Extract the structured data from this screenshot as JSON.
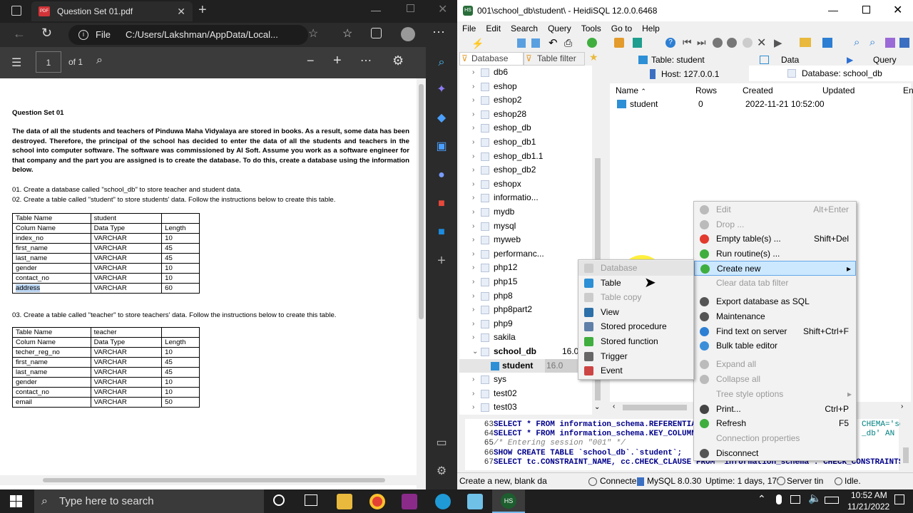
{
  "edge": {
    "tab_title": "Question Set 01.pdf",
    "file_label": "File",
    "url": "C:/Users/Lakshman/AppData/Local...",
    "page_num": "1",
    "page_total": "of 1"
  },
  "pdf": {
    "heading": "Question Set 01",
    "intro": "The data of all the students and teachers of Pinduwa Maha Vidyalaya are stored in books. As a result, some data has been destroyed. Therefore, the principal of the school has decided to enter the data of all the students and teachers in the school into computer software. The software was commissioned by AI Soft. Assume you work as a software engineer for that company and the part you are assigned is to create the database. To do this, create a database using the information below.",
    "q1": "01. Create a database called \"school_db\" to store teacher and student data.",
    "q2": "02. Create a table called \"student\" to store students' data. Follow the instructions below to create this table.",
    "q3": "03. Create a table called \"teacher\" to store teachers' data. Follow the instructions below to create this table.",
    "student_table": [
      [
        "Table Name",
        "student",
        ""
      ],
      [
        "Colum Name",
        "Data Type",
        "Length"
      ],
      [
        "index_no",
        "VARCHAR",
        "10"
      ],
      [
        "first_name",
        "VARCHAR",
        "45"
      ],
      [
        "last_name",
        "VARCHAR",
        "45"
      ],
      [
        "gender",
        "VARCHAR",
        "10"
      ],
      [
        "contact_no",
        "VARCHAR",
        "10"
      ],
      [
        "address",
        "VARCHAR",
        "60"
      ]
    ],
    "teacher_table": [
      [
        "Table Name",
        "teacher",
        ""
      ],
      [
        "Colum Name",
        "Data Type",
        "Length"
      ],
      [
        "techer_reg_no",
        "VARCHAR",
        "10"
      ],
      [
        "first_name",
        "VARCHAR",
        "45"
      ],
      [
        "last_name",
        "VARCHAR",
        "45"
      ],
      [
        "gender",
        "VARCHAR",
        "10"
      ],
      [
        "contact_no",
        "VARCHAR",
        "10"
      ],
      [
        "email",
        "VARCHAR",
        "50"
      ]
    ]
  },
  "heidi": {
    "title": "001\\school_db\\student\\ - HeidiSQL 12.0.0.6468",
    "menu": [
      "File",
      "Edit",
      "Search",
      "Query",
      "Tools",
      "Go to",
      "Help"
    ],
    "filter_db": "Database filter",
    "filter_table": "Table filter",
    "tabs": [
      "Table: student",
      "Data",
      "Query"
    ],
    "subtabs": [
      "Host: 127.0.0.1",
      "Database: school_db"
    ],
    "tree": [
      "db6",
      "eshop",
      "eshop2",
      "eshop28",
      "eshop_db",
      "eshop_db1",
      "eshop_db1.1",
      "eshop_db2",
      "eshopx",
      "informatio...",
      "mydb",
      "mysql",
      "myweb",
      "performanc...",
      "php12",
      "php15",
      "php8",
      "php8part2",
      "php9",
      "sakila",
      "school_db",
      "student",
      "sys",
      "test02",
      "test03"
    ],
    "school_size": "16.0",
    "student_size": "16.0",
    "columns": [
      "Name",
      "Rows",
      "Created",
      "Updated",
      "En"
    ],
    "row": {
      "name": "student",
      "rows": "0",
      "created": "2022-11-21 10:52:00"
    },
    "sql": [
      {
        "n": "63",
        "code": "SELECT * FROM information_schema.REFERENTIA",
        "tail": "CHEMA='sch"
      },
      {
        "n": "64",
        "code": "SELECT * FROM information_schema.KEY_COLUMN",
        "tail": "_db'   AN"
      },
      {
        "n": "65",
        "code": "/* Entering session \"001\" */",
        "tail": ""
      },
      {
        "n": "66",
        "code": "SHOW CREATE TABLE `school_db`.`student`;",
        "tail": ""
      },
      {
        "n": "67",
        "code": "SELECT tc.CONSTRAINT_NAME, cc.CHECK_CLAUSE FROM `information_schema`.`CHECK_CONSTRAINTS`",
        "tail": ""
      }
    ],
    "status": [
      "Create a new, blank da",
      "Connecte",
      "MySQL 8.0.30",
      "Uptime: 1 days, 17:",
      "Server tin",
      "Idle."
    ]
  },
  "context_main": [
    {
      "label": "Edit",
      "shortcut": "Alt+Enter",
      "disabled": true,
      "icon": "edit-icon"
    },
    {
      "label": "Drop ...",
      "shortcut": "",
      "disabled": true,
      "icon": "drop-icon"
    },
    {
      "label": "Empty table(s) ...",
      "shortcut": "Shift+Del",
      "disabled": false,
      "icon": "empty-table-icon"
    },
    {
      "label": "Run routine(s) ...",
      "shortcut": "",
      "disabled": false,
      "icon": "run-routine-icon"
    },
    {
      "label": "Create new",
      "shortcut": "",
      "disabled": false,
      "icon": "create-new-icon",
      "highlight": true
    },
    {
      "label": "Clear data tab filter",
      "shortcut": "",
      "disabled": true,
      "icon": ""
    },
    {
      "label": "Export database as SQL",
      "shortcut": "",
      "disabled": false,
      "icon": "export-icon"
    },
    {
      "label": "Maintenance",
      "shortcut": "",
      "disabled": false,
      "icon": "maintenance-icon"
    },
    {
      "label": "Find text on server",
      "shortcut": "Shift+Ctrl+F",
      "disabled": false,
      "icon": "find-icon"
    },
    {
      "label": "Bulk table editor",
      "shortcut": "",
      "disabled": false,
      "icon": "bulk-editor-icon"
    },
    {
      "label": "Expand all",
      "shortcut": "",
      "disabled": true,
      "icon": "expand-icon"
    },
    {
      "label": "Collapse all",
      "shortcut": "",
      "disabled": true,
      "icon": "collapse-icon"
    },
    {
      "label": "Tree style options",
      "shortcut": "",
      "disabled": true,
      "icon": ""
    },
    {
      "label": "Print...",
      "shortcut": "Ctrl+P",
      "disabled": false,
      "icon": "print-icon"
    },
    {
      "label": "Refresh",
      "shortcut": "F5",
      "disabled": false,
      "icon": "refresh-icon"
    },
    {
      "label": "Connection properties",
      "shortcut": "",
      "disabled": true,
      "icon": ""
    },
    {
      "label": "Disconnect",
      "shortcut": "",
      "disabled": false,
      "icon": "disconnect-icon"
    }
  ],
  "context_sub": [
    {
      "label": "Database",
      "disabled": true,
      "icon": "database-icon"
    },
    {
      "label": "Table",
      "disabled": false,
      "icon": "table-icon"
    },
    {
      "label": "Table copy",
      "disabled": true,
      "icon": "table-copy-icon"
    },
    {
      "label": "View",
      "disabled": false,
      "icon": "view-icon"
    },
    {
      "label": "Stored procedure",
      "disabled": false,
      "icon": "procedure-icon"
    },
    {
      "label": "Stored function",
      "disabled": false,
      "icon": "function-icon"
    },
    {
      "label": "Trigger",
      "disabled": false,
      "icon": "trigger-icon"
    },
    {
      "label": "Event",
      "disabled": false,
      "icon": "event-icon"
    }
  ],
  "taskbar": {
    "search_placeholder": "Type here to search",
    "time": "10:52 AM",
    "date": "11/21/2022"
  },
  "colors": {
    "highlight": "#cce8ff",
    "menu_hover": "#3399ff",
    "accent": "#0078d7"
  }
}
